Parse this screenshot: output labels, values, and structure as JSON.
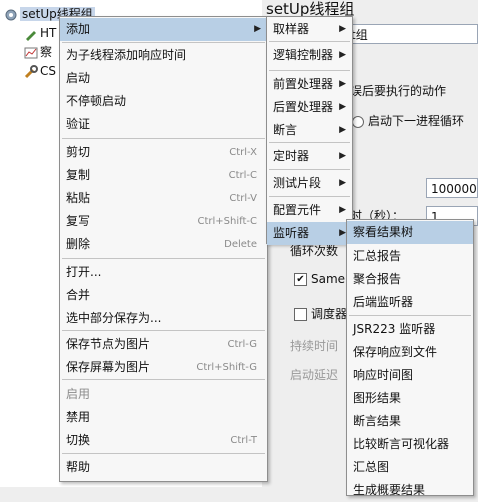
{
  "tree": {
    "root": "setUp线程组",
    "items": [
      "HT",
      "察",
      "CS"
    ]
  },
  "panel": {
    "title": "setUp线程组",
    "name_value": "t组",
    "error_action": "误后要执行的动作",
    "radio_next_loop": "启动下一进程循环",
    "threads_value": "1000000",
    "rampup_label": "时（秒）：",
    "rampup_value": "1",
    "loop_label": "循环次数",
    "same_user": "Same",
    "scheduler": "调度器",
    "duration": "持续时间",
    "startup_delay": "启动延迟"
  },
  "context_menu": {
    "items": [
      {
        "label": "添加",
        "submenu": true
      },
      {
        "label": "为子线程添加响应时间"
      },
      {
        "label": "启动"
      },
      {
        "label": "不停顿启动"
      },
      {
        "label": "验证"
      },
      {
        "label": "剪切",
        "shortcut": "Ctrl-X"
      },
      {
        "label": "复制",
        "shortcut": "Ctrl-C"
      },
      {
        "label": "粘贴",
        "shortcut": "Ctrl-V"
      },
      {
        "label": "复写",
        "shortcut": "Ctrl+Shift-C"
      },
      {
        "label": "删除",
        "shortcut": "Delete"
      },
      {
        "label": "打开..."
      },
      {
        "label": "合并"
      },
      {
        "label": "选中部分保存为..."
      },
      {
        "label": "保存节点为图片",
        "shortcut": "Ctrl-G"
      },
      {
        "label": "保存屏幕为图片",
        "shortcut": "Ctrl+Shift-G"
      },
      {
        "label": "启用"
      },
      {
        "label": "禁用"
      },
      {
        "label": "切换",
        "shortcut": "Ctrl-T"
      },
      {
        "label": "帮助"
      }
    ]
  },
  "add_menu": {
    "items": [
      "取样器",
      "逻辑控制器",
      "前置处理器",
      "后置处理器",
      "断言",
      "定时器",
      "测试片段",
      "配置元件",
      "监听器"
    ]
  },
  "listener_menu": {
    "items": [
      "察看结果树",
      "汇总报告",
      "聚合报告",
      "后端监听器",
      "JSR223 监听器",
      "保存响应到文件",
      "响应时间图",
      "图形结果",
      "断言结果",
      "比较断言可视化器",
      "汇总图",
      "生成概要结果"
    ]
  }
}
